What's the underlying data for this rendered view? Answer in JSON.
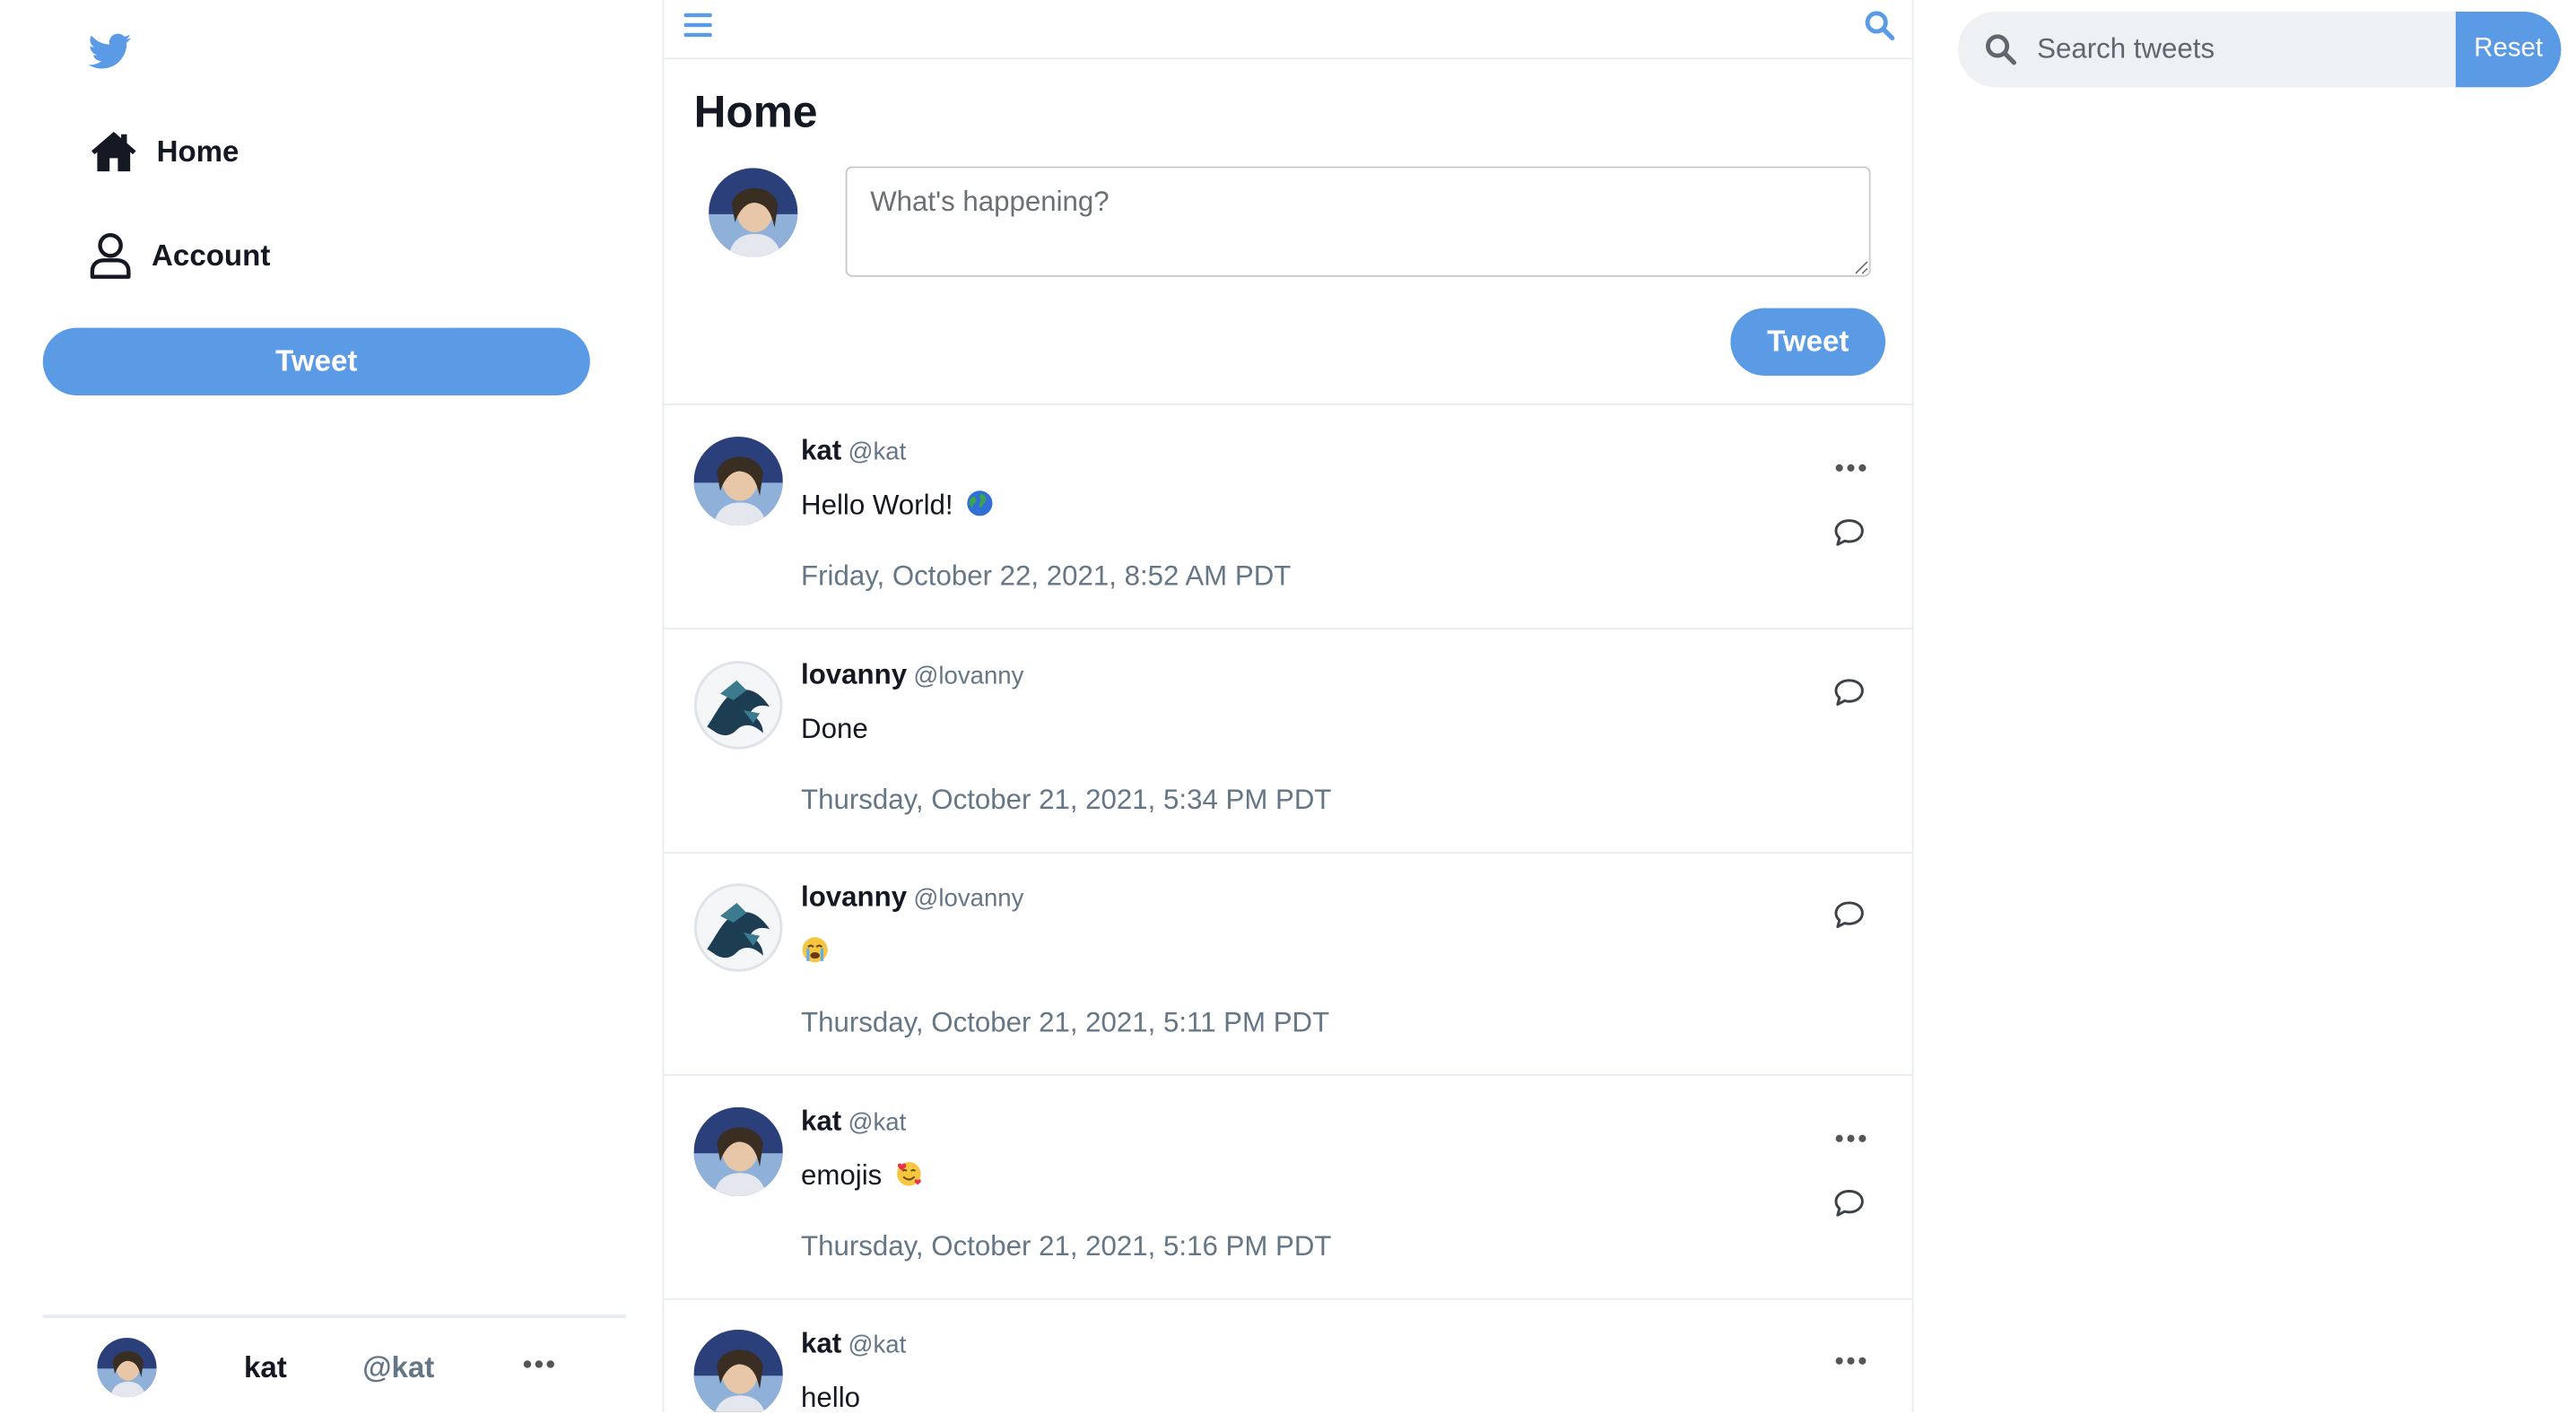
{
  "colors": {
    "accent": "#5b9be6",
    "muted": "#657786",
    "divider": "#e6ecf0"
  },
  "sidebar": {
    "logo_icon": "twitter-bird-icon",
    "items": [
      {
        "label": "Home",
        "icon": "home-icon"
      },
      {
        "label": "Account",
        "icon": "user-icon"
      }
    ],
    "tweet_button": "Tweet",
    "profile": {
      "name": "kat",
      "handle": "@kat",
      "more_icon": "ellipsis-icon"
    }
  },
  "topbar": {
    "menu_icon": "hamburger-menu-icon",
    "search_icon": "search-icon"
  },
  "main": {
    "title": "Home",
    "compose": {
      "placeholder": "What's happening?",
      "button": "Tweet"
    },
    "tweets": [
      {
        "name": "kat",
        "handle": "@kat",
        "text": "Hello World!",
        "emoji": "globe-emoji",
        "date": "Friday, October 22, 2021, 8:52 AM PDT",
        "own": true
      },
      {
        "name": "lovanny",
        "handle": "@lovanny",
        "text": "Done",
        "emoji": "",
        "date": "Thursday, October 21, 2021, 5:34 PM PDT",
        "own": false
      },
      {
        "name": "lovanny",
        "handle": "@lovanny",
        "text": "",
        "emoji": "crying-face-emoji",
        "date": "Thursday, October 21, 2021, 5:11 PM PDT",
        "own": false
      },
      {
        "name": "kat",
        "handle": "@kat",
        "text": "emojis",
        "emoji": "smiling-hearts-emoji",
        "date": "Thursday, October 21, 2021, 5:16 PM PDT",
        "own": true
      },
      {
        "name": "kat",
        "handle": "@kat",
        "text": "hello",
        "emoji": "",
        "date": "",
        "own": true
      }
    ]
  },
  "right": {
    "search": {
      "placeholder": "Search tweets",
      "value": ""
    },
    "reset_button": "Reset"
  }
}
